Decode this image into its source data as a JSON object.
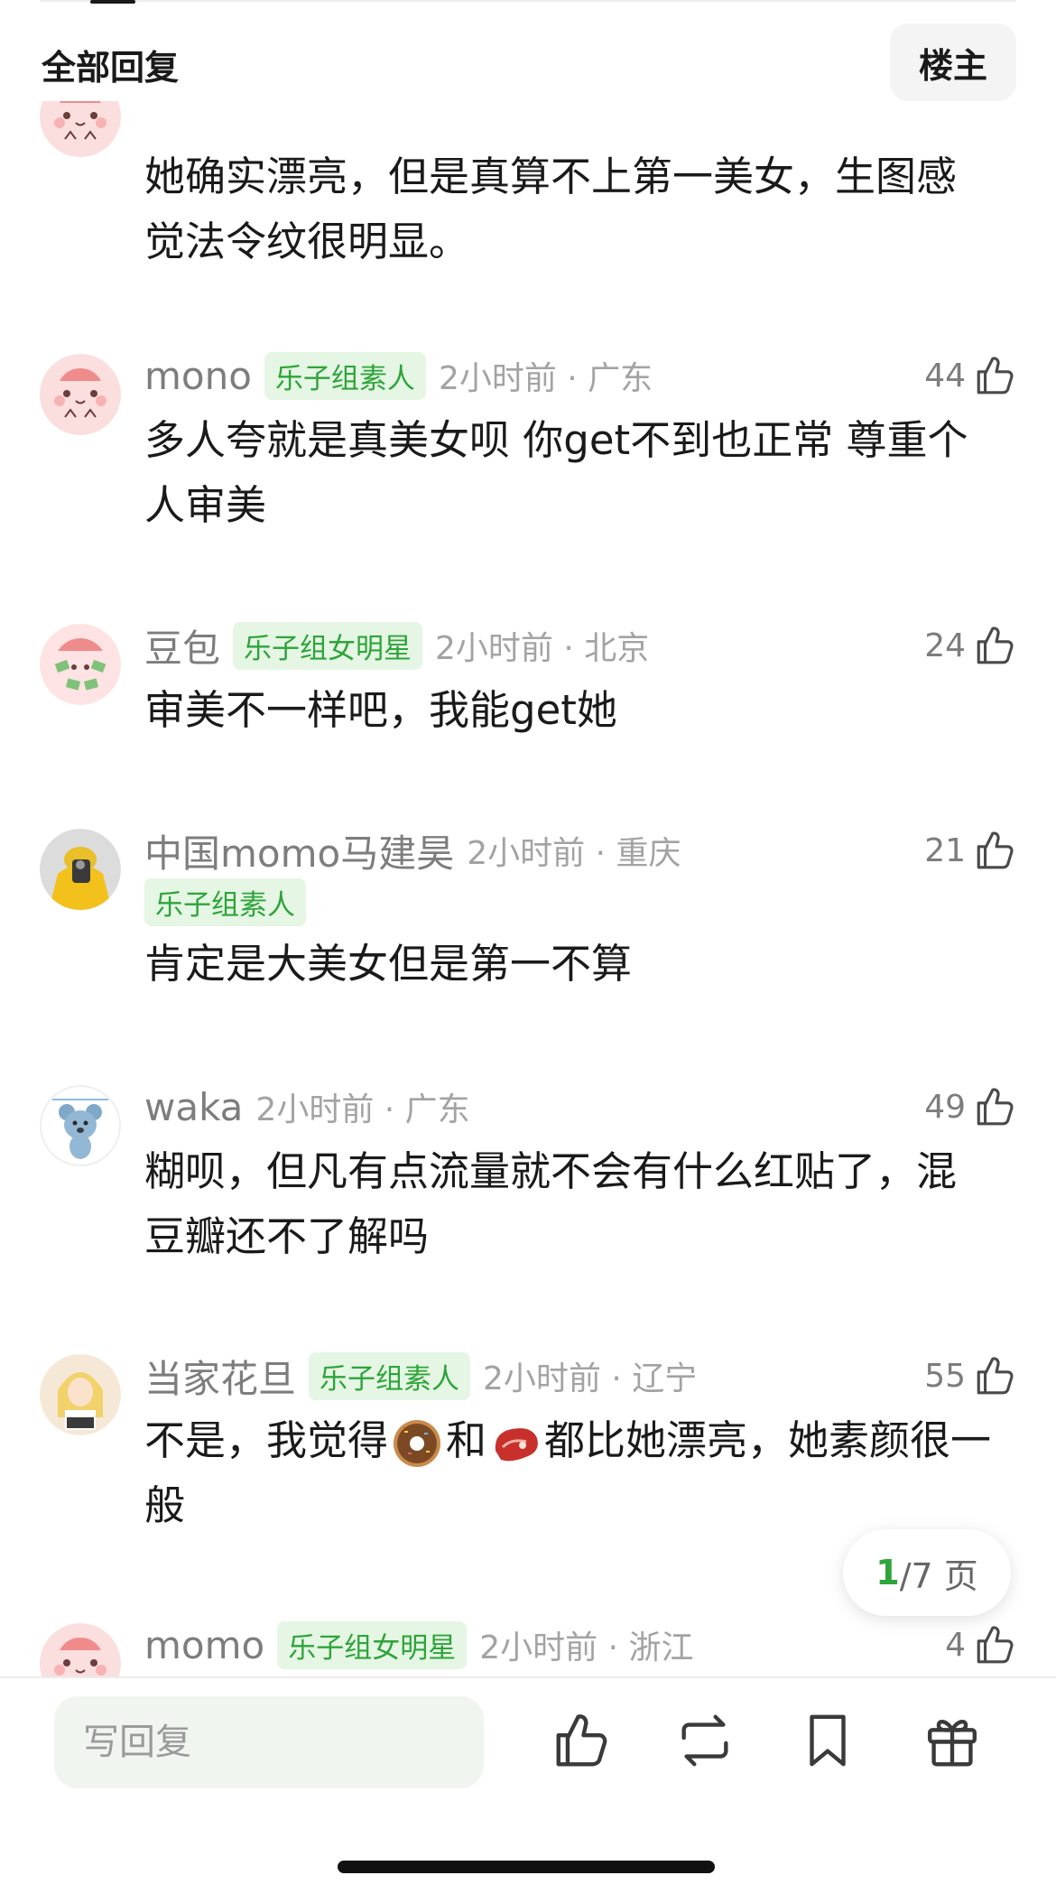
{
  "header": {
    "title": "全部回复",
    "op_label": "楼主"
  },
  "comments": [
    {
      "content": "她确实漂亮，但是真算不上第一美女，生图感觉法令纹很明显。"
    },
    {
      "username": "mono",
      "badge": "乐子组素人",
      "time_location": "2小时前 · 广东",
      "likes": "44",
      "content": "多人夸就是真美女呗 你get不到也正常 尊重个人审美"
    },
    {
      "username": "豆包",
      "badge": "乐子组女明星",
      "time_location": "2小时前 · 北京",
      "likes": "24",
      "content": "审美不一样吧，我能get她"
    },
    {
      "username": "中国momo马建昊",
      "badge": "乐子组素人",
      "time_location": "2小时前 · 重庆",
      "likes": "21",
      "content": "肯定是大美女但是第一不算"
    },
    {
      "username": "waka",
      "time_location": "2小时前 · 广东",
      "likes": "49",
      "content": "糊呗，但凡有点流量就不会有什么红贴了，混豆瓣还不了解吗"
    },
    {
      "username": "当家花旦",
      "badge": "乐子组素人",
      "time_location": "2小时前 · 辽宁",
      "likes": "55",
      "content_before": "不是，我觉得",
      "emoji1": "donut",
      "content_mid": "和",
      "emoji2": "meat",
      "content_after": "都比她漂亮，她素颜很一般"
    },
    {
      "username": "momo",
      "badge": "乐子组女明星",
      "time_location": "2小时前 · 浙江",
      "likes": "4"
    }
  ],
  "pagination": {
    "current": "1",
    "total_text": "/7 页"
  },
  "bottom_bar": {
    "reply_placeholder": "写回复",
    "icons": [
      "thumbs-up-icon",
      "repost-icon",
      "bookmark-icon",
      "gift-icon"
    ]
  },
  "colors": {
    "accent_green": "#2ea43a",
    "badge_bg": "#e5f6e4"
  }
}
